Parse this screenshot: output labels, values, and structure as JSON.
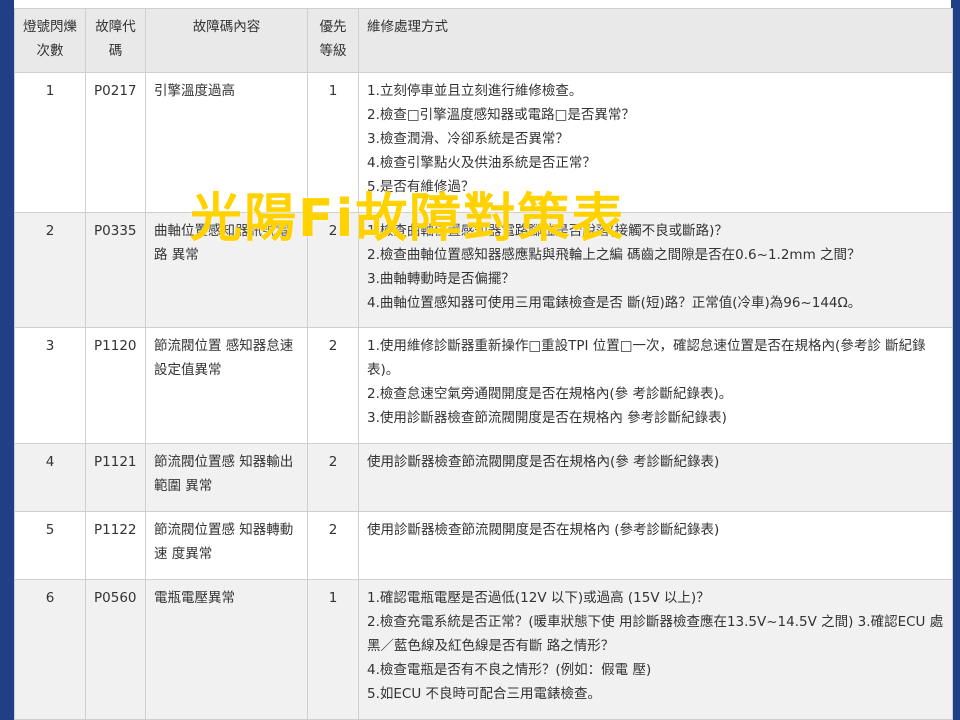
{
  "headers": {
    "blink_count": "燈號閃爍次數",
    "code": "故障代碼",
    "description": "故障碼內容",
    "priority": "優先等級",
    "repair": "維修處理方式"
  },
  "rows": [
    {
      "blink": "1",
      "code": "P0217",
      "description": "引擎溫度過高",
      "priority": "1",
      "repair": [
        "1.立刻停車並且立刻進行維修檢查。",
        "2.檢查□引擎溫度感知器或電路□是否異常？",
        "3.檢查潤滑、冷卻系統是否異常？",
        "4.檢查引擎點火及供油系統是否正常？",
        "5.是否有維修過？"
      ]
    },
    {
      "blink": "2",
      "code": "P0335",
      "description": "曲軸位置感知器訊號電路 異常",
      "priority": "2",
      "repair": [
        "1.檢查曲軸位置感知器電路腳位是否脫落(接觸不良或斷路)？",
        "2.檢查曲軸位置感知器感應點與飛輪上之編 碼齒之間隙是否在0.6~1.2mm 之間？",
        "3.曲軸轉動時是否偏擺？",
        "4.曲軸位置感知器可使用三用電錶檢查是否 斷(短)路？正常值(冷車)為96~144Ω。"
      ]
    },
    {
      "blink": "3",
      "code": "P1120",
      "description": "節流閥位置 感知器怠速 設定值異常",
      "priority": "2",
      "repair": [
        "1.使用維修診斷器重新操作□重設TPI 位置□一次，確認怠速位置是否在規格內(參考診 斷紀錄表)。",
        "2.檢查怠速空氣旁通閥開度是否在規格內(參 考診斷紀錄表)。",
        "3.使用診斷器檢查節流閥開度是否在規格內 參考診斷紀錄表)"
      ]
    },
    {
      "blink": "4",
      "code": "P1121",
      "description": "節流閥位置感 知器輸出範圍 異常",
      "priority": "2",
      "repair": [
        "使用診斷器檢查節流閥開度是否在規格內(參 考診斷紀錄表)"
      ]
    },
    {
      "blink": "5",
      "code": "P1122",
      "description": "節流閥位置感 知器轉動速 度異常",
      "priority": "2",
      "repair": [
        "使用診斷器檢查節流閥開度是否在規格內 (參考診斷紀錄表)"
      ]
    },
    {
      "blink": "6",
      "code": "P0560",
      "description": "電瓶電壓異常",
      "priority": "1",
      "repair": [
        "1.確認電瓶電壓是否過低(12V 以下)或過高 (15V 以上)？",
        "2.檢查充電系統是否正常？(暖車狀態下使 用診斷器檢查應在13.5V~14.5V 之間) 3.確認ECU 處黑／藍色線及紅色線是否有斷 路之情形？",
        "4.檢查電瓶是否有不良之情形？(例如：假電 壓)",
        "5.如ECU 不良時可配合三用電錶檢查。"
      ]
    }
  ],
  "overlay_title": "光陽Fi故障對策表",
  "colors": {
    "frame": "#1f3f86",
    "header_bg": "#e9e9e9",
    "even_row_bg": "#f1f1f1",
    "overlay": "#ffd200"
  }
}
